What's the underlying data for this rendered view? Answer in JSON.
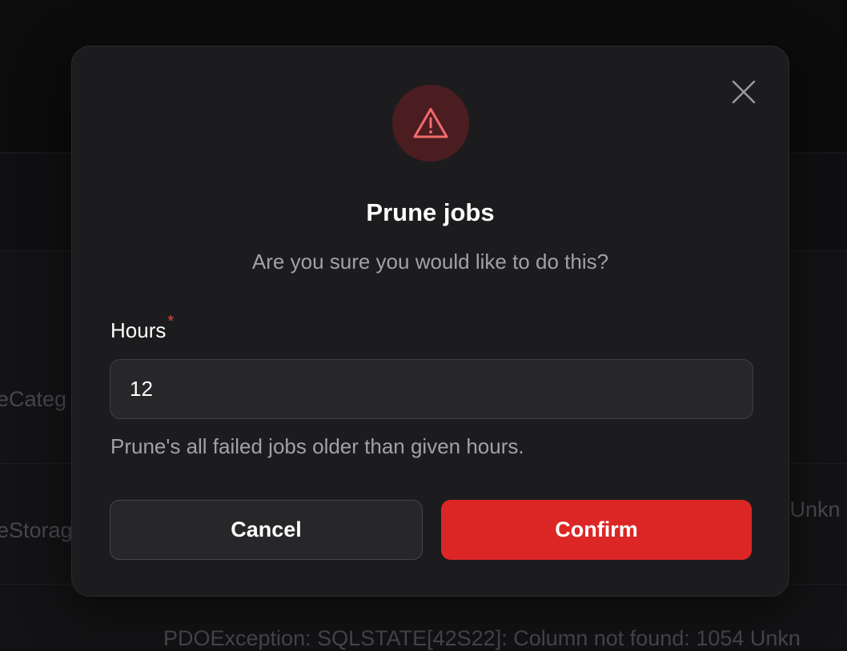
{
  "background": {
    "row_texts": [
      "eCateg",
      "eStorag",
      "- Unkn",
      "PDOException: SQLSTATE[42S22]: Column not found: 1054 Unkn"
    ]
  },
  "modal": {
    "icon": "alert-triangle-icon",
    "close_icon": "close-icon",
    "title": "Prune jobs",
    "description": "Are you sure you would like to do this?",
    "field": {
      "label": "Hours",
      "required_marker": "*",
      "value": "12",
      "helper": "Prune's all failed jobs older than given hours."
    },
    "actions": {
      "cancel_label": "Cancel",
      "confirm_label": "Confirm"
    }
  },
  "colors": {
    "danger": "#dc2626",
    "danger_icon_bg": "#4b1d21",
    "modal_bg": "#1c1c1e",
    "page_bg": "#111113"
  }
}
